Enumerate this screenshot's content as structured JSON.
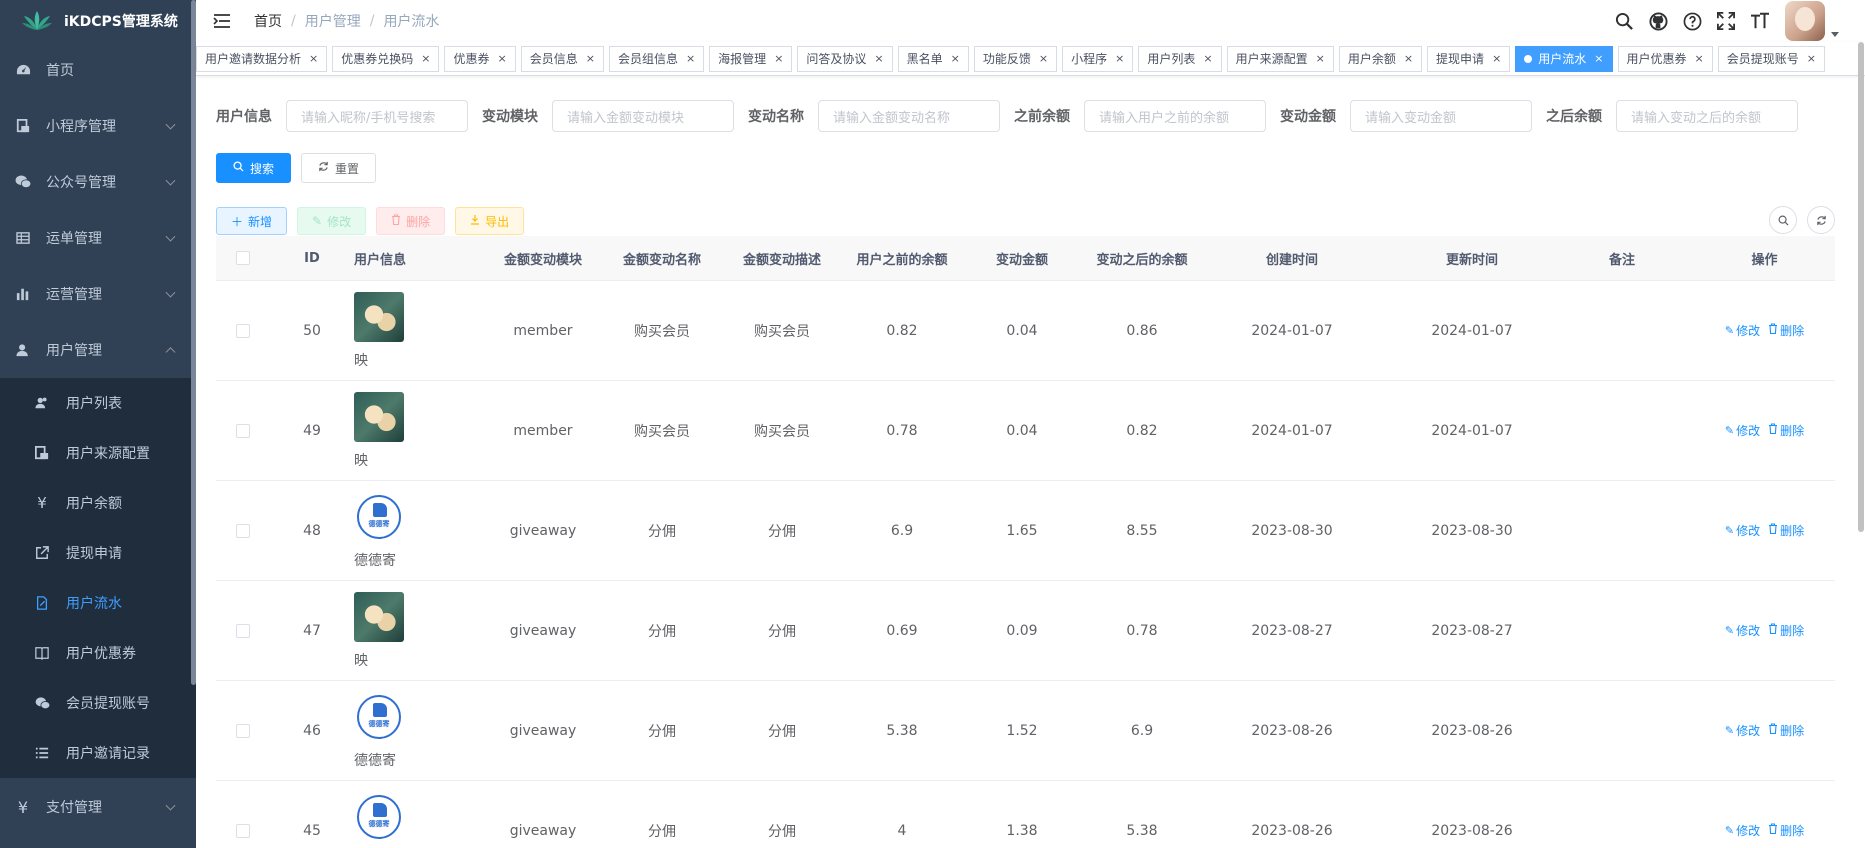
{
  "app": {
    "title": "iKDCPS管理系统"
  },
  "sidebar": {
    "items": [
      {
        "label": "首页",
        "icon": "dashboard-icon"
      },
      {
        "label": "小程序管理",
        "icon": "miniprogram-icon"
      },
      {
        "label": "公众号管理",
        "icon": "wechat-icon"
      },
      {
        "label": "运单管理",
        "icon": "waybill-icon"
      },
      {
        "label": "运营管理",
        "icon": "chart-icon"
      },
      {
        "label": "用户管理",
        "icon": "user-icon"
      }
    ],
    "sub_items": [
      {
        "label": "用户列表",
        "icon": "peoples-icon"
      },
      {
        "label": "用户来源配置",
        "icon": "source-icon"
      },
      {
        "label": "用户余额",
        "icon": "yen-icon"
      },
      {
        "label": "提现申请",
        "icon": "external-link-icon"
      },
      {
        "label": "用户流水",
        "icon": "edit-doc-icon"
      },
      {
        "label": "用户优惠券",
        "icon": "book-icon"
      },
      {
        "label": "会员提现账号",
        "icon": "wechat-icon"
      },
      {
        "label": "用户邀请记录",
        "icon": "list-icon"
      }
    ],
    "pay": {
      "label": "支付管理",
      "icon": "yen-icon"
    }
  },
  "breadcrumb": [
    "首页",
    "用户管理",
    "用户流水"
  ],
  "tags": [
    "用户邀请数据分析",
    "优惠券兑换码",
    "优惠券",
    "会员信息",
    "会员组信息",
    "海报管理",
    "问答及协议",
    "黑名单",
    "功能反馈",
    "小程序",
    "用户列表",
    "用户来源配置",
    "用户余额",
    "提现申请",
    "用户流水",
    "用户优惠券",
    "会员提现账号"
  ],
  "active_tag": "用户流水",
  "search": {
    "fields": [
      {
        "label": "用户信息",
        "placeholder": "请输入昵称/手机号搜索"
      },
      {
        "label": "变动模块",
        "placeholder": "请输入金额变动模块"
      },
      {
        "label": "变动名称",
        "placeholder": "请输入金额变动名称"
      },
      {
        "label": "之前余额",
        "placeholder": "请输入用户之前的余额"
      },
      {
        "label": "变动金额",
        "placeholder": "请输入变动金额"
      },
      {
        "label": "之后余额",
        "placeholder": "请输入变动之后的余额"
      }
    ],
    "search_label": "搜索",
    "reset_label": "重置"
  },
  "toolbar": {
    "add": "新增",
    "edit": "修改",
    "delete": "删除",
    "export": "导出"
  },
  "table": {
    "headers": [
      "ID",
      "用户信息",
      "金额变动模块",
      "金额变动名称",
      "金额变动描述",
      "用户之前的余额",
      "变动金额",
      "变动之后的余额",
      "创建时间",
      "更新时间",
      "备注",
      "操作"
    ],
    "rows": [
      {
        "id": "50",
        "user": "映",
        "avatar": "flower",
        "module": "member",
        "name": "购买会员",
        "desc": "购买会员",
        "before": "0.82",
        "amount": "0.04",
        "after": "0.86",
        "created": "2024-01-07",
        "updated": "2024-01-07",
        "remark": ""
      },
      {
        "id": "49",
        "user": "映",
        "avatar": "flower",
        "module": "member",
        "name": "购买会员",
        "desc": "购买会员",
        "before": "0.78",
        "amount": "0.04",
        "after": "0.82",
        "created": "2024-01-07",
        "updated": "2024-01-07",
        "remark": ""
      },
      {
        "id": "48",
        "user": "德德寄",
        "avatar": "logo",
        "module": "giveaway",
        "name": "分佣",
        "desc": "分佣",
        "before": "6.9",
        "amount": "1.65",
        "after": "8.55",
        "created": "2023-08-30",
        "updated": "2023-08-30",
        "remark": ""
      },
      {
        "id": "47",
        "user": "映",
        "avatar": "flower",
        "module": "giveaway",
        "name": "分佣",
        "desc": "分佣",
        "before": "0.69",
        "amount": "0.09",
        "after": "0.78",
        "created": "2023-08-27",
        "updated": "2023-08-27",
        "remark": ""
      },
      {
        "id": "46",
        "user": "德德寄",
        "avatar": "logo",
        "module": "giveaway",
        "name": "分佣",
        "desc": "分佣",
        "before": "5.38",
        "amount": "1.52",
        "after": "6.9",
        "created": "2023-08-26",
        "updated": "2023-08-26",
        "remark": ""
      },
      {
        "id": "45",
        "user": "德德寄",
        "avatar": "logo",
        "module": "giveaway",
        "name": "分佣",
        "desc": "分佣",
        "before": "4",
        "amount": "1.38",
        "after": "5.38",
        "created": "2023-08-26",
        "updated": "2023-08-26",
        "remark": ""
      }
    ],
    "op_edit": "修改",
    "op_delete": "删除"
  },
  "colors": {
    "sidebar_bg": "#304156",
    "submenu_bg": "#1f2d3d",
    "primary": "#1890ff",
    "active_tag": "#409eff"
  }
}
